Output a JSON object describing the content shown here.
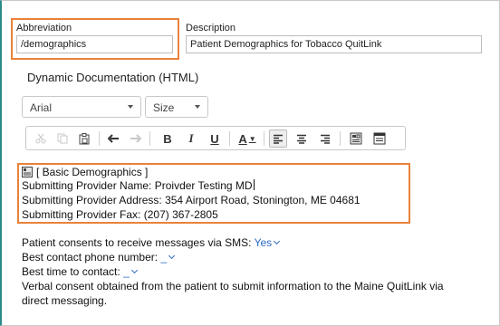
{
  "abbreviation": {
    "label": "Abbreviation",
    "value": "/demographics"
  },
  "description": {
    "label": "Description",
    "value": "Patient Demographics for Tobacco QuitLink"
  },
  "section_title": "Dynamic Documentation (HTML)",
  "toolbar": {
    "font_select": "Arial",
    "size_select": "Size",
    "bold": "B",
    "italic": "I",
    "underline": "U",
    "font_color": "A"
  },
  "editor": {
    "lines": [
      "[ Basic Demographics ]",
      "Submitting Provider Name: Proivder Testing MD",
      "Submitting Provider Address: 354 Airport Road, Stonington, ME 04681",
      "Submitting Provider Fax: (207) 367-2805"
    ]
  },
  "body": {
    "sms_label": "Patient consents to receive messages via SMS:",
    "sms_value": "Yes",
    "phone_label": "Best contact phone number:",
    "phone_value": "_",
    "time_label": "Best time to contact:",
    "time_value": "_",
    "consent_line1": "Verbal consent obtained from the patient to submit information to the Maine QuitLink via",
    "consent_line2": "direct messaging."
  },
  "colors": {
    "highlight": "#e8823a",
    "link": "#2a6bc0"
  }
}
